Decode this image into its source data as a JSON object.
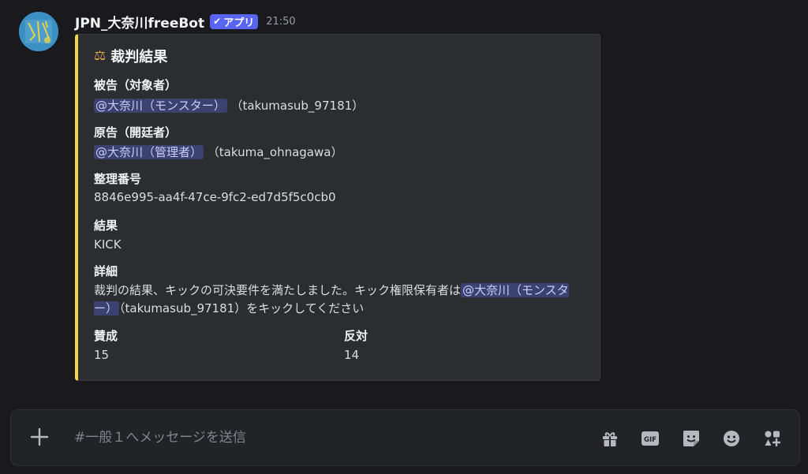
{
  "message": {
    "username": "JPN_大奈川freeBot",
    "badge": "アプリ",
    "timestamp": "21:50"
  },
  "embed": {
    "title": "裁判結果",
    "accent_color": "#f0d84b",
    "defendant": {
      "label": "被告（対象者）",
      "mention": "@大奈川（モンスター）",
      "handle": "（takumasub_97181）"
    },
    "plaintiff": {
      "label": "原告（開廷者）",
      "mention": "@大奈川（管理者）",
      "handle": "（takuma_ohnagawa）"
    },
    "case_number": {
      "label": "整理番号",
      "value": "8846e995-aa4f-47ce-9fc2-ed7d5f5c0cb0"
    },
    "result": {
      "label": "結果",
      "value": "KICK"
    },
    "details": {
      "label": "詳細",
      "text_before": "裁判の結果、キックの可決要件を満たしました。キック権限保有者は",
      "mention": "@大奈川（モンスター）",
      "text_after": "（takumasub_97181）をキックしてください"
    },
    "votes": {
      "for_label": "賛成",
      "for_value": "15",
      "against_label": "反対",
      "against_value": "14"
    }
  },
  "composer": {
    "placeholder": "#一般１へメッセージを送信",
    "gif_label": "GIF"
  }
}
